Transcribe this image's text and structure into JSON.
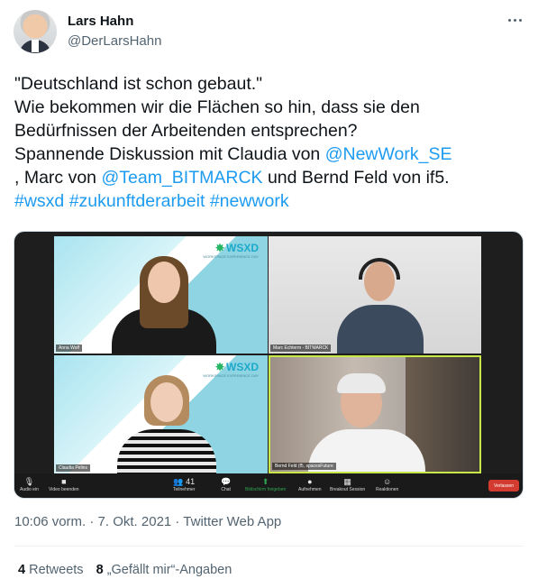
{
  "author": {
    "name": "Lars Hahn",
    "handle": "@DerLarsHahn"
  },
  "tweet": {
    "line1": "\"Deutschland ist schon gebaut.\"",
    "line2": "Wie bekommen wir die Flächen so hin, dass sie den",
    "line3": "Bedürfnissen der Arbeitenden entsprechen?",
    "line4_text": "Spannende Diskussion mit Claudia von ",
    "mention1": "@NewWork_SE",
    "line5_text_a": ", Marc von ",
    "mention2": "@Team_BITMARCK",
    "line5_text_b": " und Bernd Feld von if5.",
    "hashtag1": "#wsxd",
    "hashtag2": "#zukunftderarbeit",
    "hashtag3": "#newwork"
  },
  "media": {
    "brand": "WSXD",
    "brand_sub": "WORKSPACE EXPERIENCE DAY",
    "participants": [
      {
        "name": "Anna Wolf"
      },
      {
        "name": "Marc Echterm - BITMARCK"
      },
      {
        "name": "Claudia Pelins"
      },
      {
        "name": "Bernd Feld (f5, spacesFuture"
      }
    ],
    "toolbar": {
      "audio": "Audio ein",
      "video": "Video beenden",
      "participants": "Teilnehmer",
      "participants_count": "41",
      "chat": "Chat",
      "share": "Bildschirm freigeben",
      "record": "Aufnehmen",
      "breakout": "Breakout Session",
      "reactions": "Reaktionen",
      "leave": "Verlassen"
    }
  },
  "meta": "10:06 vorm. · 7. Okt. 2021 · Twitter Web App",
  "stats": {
    "retweets_count": "4",
    "retweets_label": "Retweets",
    "likes_count": "8",
    "likes_label": "„Gefällt mir“-Angaben"
  },
  "colors": {
    "link": "#1d9bf0",
    "secondary_text": "#536471",
    "primary_text": "#0f1419"
  }
}
